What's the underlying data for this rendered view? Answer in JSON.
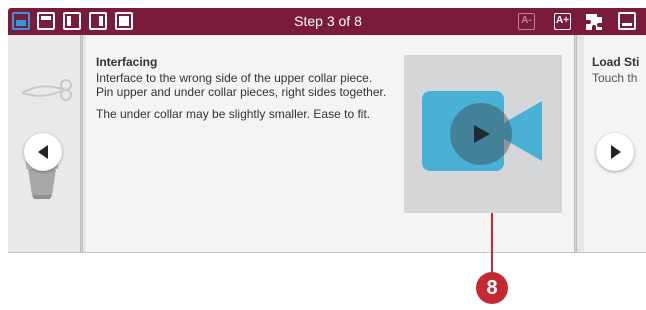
{
  "topbar": {
    "step_label": "Step 3 of 8",
    "font_decrease_label": "A-",
    "font_increase_label": "A+",
    "accent_color": "#7a1b3c",
    "active_color": "#2b9ad9"
  },
  "current_step": {
    "title": "Interfacing",
    "paragraph_1": "Interface to the wrong side of the upper collar piece. Pin upper and under collar pieces, right sides together.",
    "paragraph_2": "The under collar may be slightly smaller. Ease to fit."
  },
  "next_step": {
    "title": "Load Sti",
    "subtitle": "Touch th"
  },
  "callout": {
    "number": "8",
    "color": "#c62833"
  },
  "icons": {
    "prev": "arrow-left-icon",
    "next": "arrow-right-icon",
    "video": "video-camera-icon",
    "play": "play-icon"
  }
}
